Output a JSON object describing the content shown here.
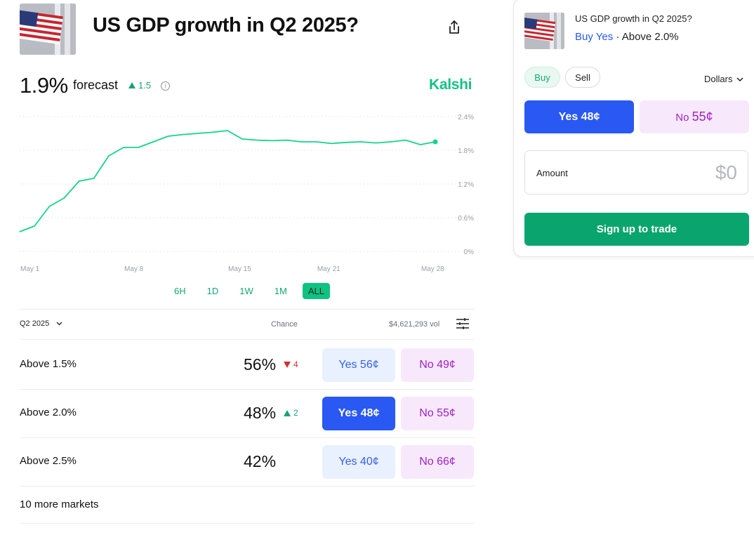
{
  "market": {
    "title": "US GDP growth in Q2 2025?",
    "forecast_value": "1.9%",
    "forecast_label": "forecast",
    "forecast_change": "1.5",
    "brand": "Kalshi"
  },
  "chart_data": {
    "type": "line",
    "y_ticks": [
      "2.4%",
      "1.8%",
      "1.2%",
      "0.6%",
      "0%"
    ],
    "x_ticks": [
      "May 1",
      "May 8",
      "May 15",
      "May 21",
      "May 28"
    ],
    "ylim": [
      0,
      2.4
    ],
    "grid": "dotted horizontal",
    "series": [
      {
        "color": "#14d48b",
        "x": [
          "May 1",
          "May 2",
          "May 3",
          "May 4",
          "May 5",
          "May 6",
          "May 7",
          "May 8",
          "May 9",
          "May 10",
          "May 11",
          "May 12",
          "May 13",
          "May 14",
          "May 15",
          "May 16",
          "May 17",
          "May 18",
          "May 19",
          "May 20",
          "May 21",
          "May 22",
          "May 23",
          "May 24",
          "May 25",
          "May 26",
          "May 27",
          "May 28",
          "May 29"
        ],
        "values": [
          0.35,
          0.45,
          0.8,
          0.95,
          1.25,
          1.3,
          1.7,
          1.85,
          1.85,
          1.95,
          2.05,
          2.08,
          2.1,
          2.12,
          2.15,
          2.0,
          1.98,
          1.97,
          1.98,
          1.95,
          1.95,
          1.92,
          1.94,
          1.95,
          1.93,
          1.95,
          1.98,
          1.9,
          1.95
        ]
      }
    ],
    "ranges": [
      "6H",
      "1D",
      "1W",
      "1M",
      "ALL"
    ],
    "active_range": "ALL"
  },
  "table": {
    "period": "Q2 2025",
    "chance_header": "Chance",
    "volume": "$4,621,293 vol",
    "rows": [
      {
        "label": "Above 1.5%",
        "chance": "56%",
        "change": "4",
        "dir": "down",
        "yes": "Yes 56¢",
        "no": "No 49¢"
      },
      {
        "label": "Above 2.0%",
        "chance": "48%",
        "change": "2",
        "dir": "up",
        "yes": "Yes 48¢",
        "no": "No 55¢"
      },
      {
        "label": "Above 2.5%",
        "chance": "42%",
        "change": "",
        "dir": "",
        "yes": "Yes 40¢",
        "no": "No 66¢"
      }
    ],
    "more": "10 more markets"
  },
  "trade": {
    "title": "US GDP growth in Q2 2025?",
    "side": "Buy Yes",
    "separator": " · ",
    "market": "Above 2.0%",
    "buy": "Buy",
    "sell": "Sell",
    "unit": "Dollars",
    "yes_prefix": "Yes",
    "yes_price": "48¢",
    "no_prefix": "No",
    "no_price": "55¢",
    "amount_label": "Amount",
    "amount_value": "$0",
    "cta": "Sign up to trade"
  }
}
